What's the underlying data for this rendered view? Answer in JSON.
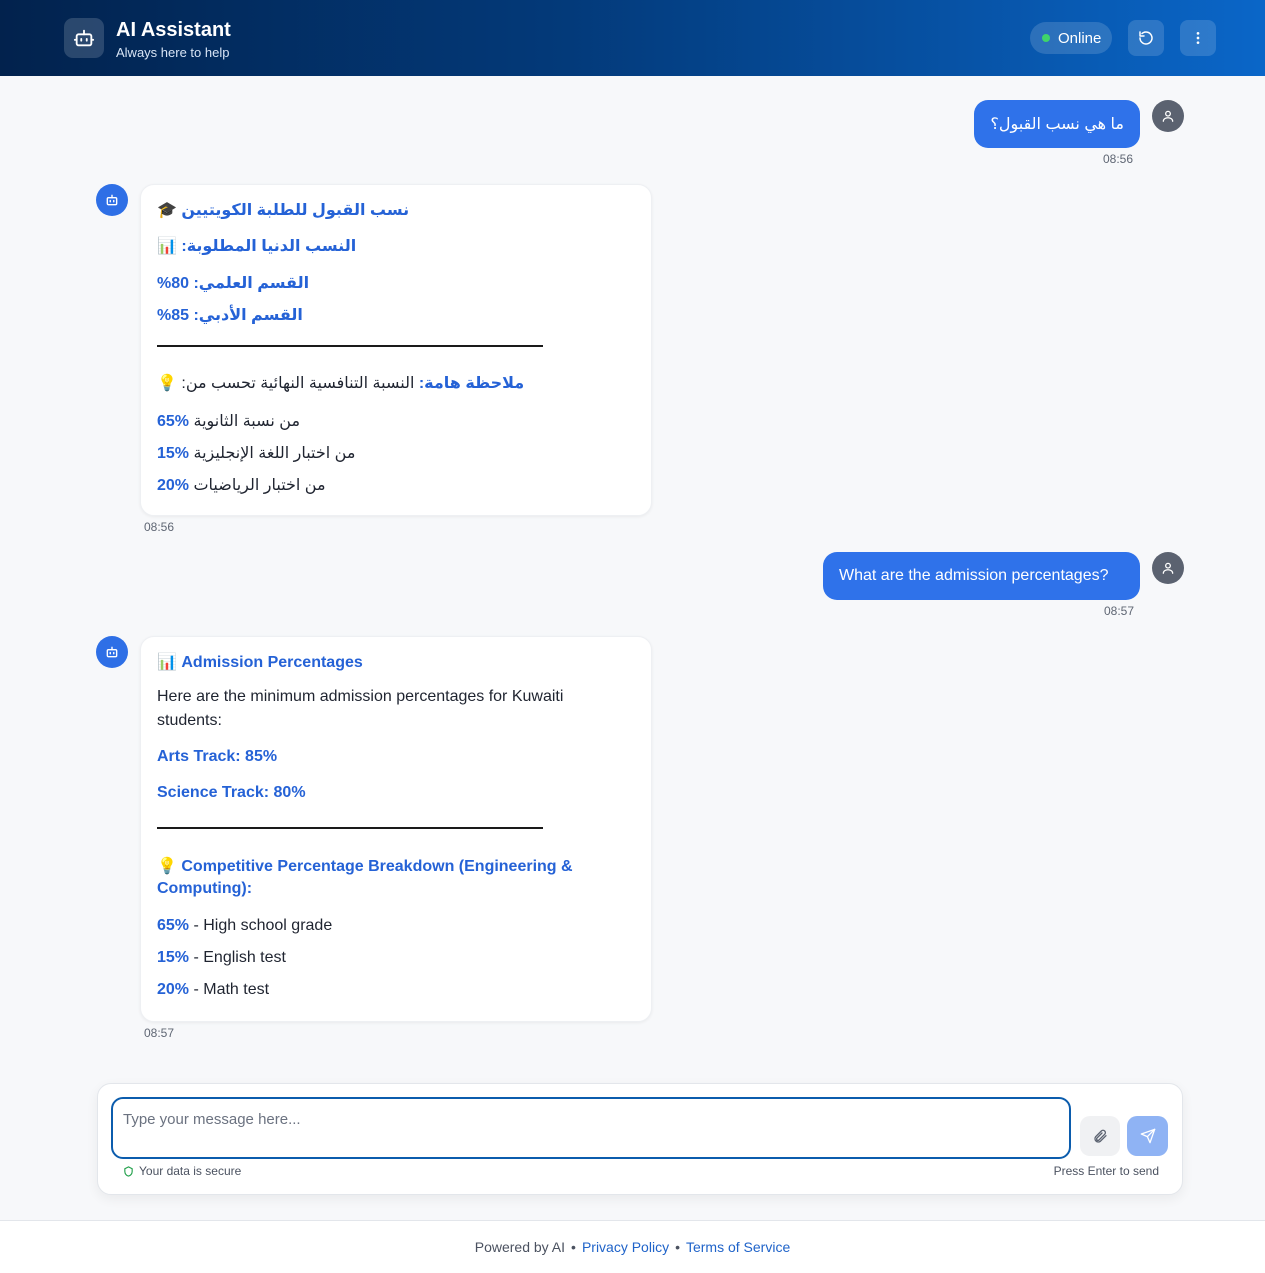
{
  "header": {
    "title": "AI Assistant",
    "subtitle": "Always here to help",
    "status": "Online",
    "logo_icon": "robot-icon",
    "refresh_icon": "refresh-icon",
    "menu_icon": "more-vertical-icon",
    "colors": {
      "gradient_start": "#02224d",
      "gradient_end": "#0a66c8",
      "status_dot": "#3fd46a"
    }
  },
  "messages": [
    {
      "role": "user",
      "text": "ما هي نسب القبول؟",
      "time": "08:56"
    },
    {
      "role": "assistant",
      "time": "08:56",
      "heading_emoji": "🎓",
      "heading": "نسب القبول للطلبة الكويتيين",
      "sub_emoji": "📊",
      "subheading": "النسب الدنيا المطلوبة:",
      "science": "القسم العلمي: 80%",
      "arts": "القسم الأدبي: 85%",
      "note_emoji": "💡",
      "note_label": "ملاحظة هامة:",
      "note_text": "النسبة التنافسية النهائية تحسب من:",
      "breakdown": [
        {
          "pct": "65%",
          "text": "من نسبة الثانوية"
        },
        {
          "pct": "15%",
          "text": "من اختبار اللغة الإنجليزية"
        },
        {
          "pct": "20%",
          "text": "من اختبار الرياضيات"
        }
      ]
    },
    {
      "role": "user",
      "text": "What are the admission percentages?",
      "time": "08:57"
    },
    {
      "role": "assistant",
      "time": "08:57",
      "heading_emoji": "📊",
      "heading": "Admission Percentages",
      "intro_line1": "Here are the minimum admission percentages for Kuwaiti",
      "intro_line2": "students:",
      "arts": "Arts Track: 85%",
      "science": "Science Track: 80%",
      "note_emoji": "💡",
      "note_line1": "Competitive Percentage Breakdown (Engineering &",
      "note_line2": "Computing):",
      "breakdown": [
        {
          "pct": "65%",
          "text": " - High school grade"
        },
        {
          "pct": "15%",
          "text": " - English test"
        },
        {
          "pct": "20%",
          "text": " - Math test"
        }
      ]
    }
  ],
  "composer": {
    "placeholder": "Type your message here...",
    "secure_text": "Your data is secure",
    "hint": "Press Enter to send",
    "attach_icon": "paperclip-icon",
    "send_icon": "send-icon"
  },
  "footer": {
    "powered": "Powered by AI",
    "privacy": "Privacy Policy",
    "terms": "Terms of Service",
    "bullet": "•"
  }
}
